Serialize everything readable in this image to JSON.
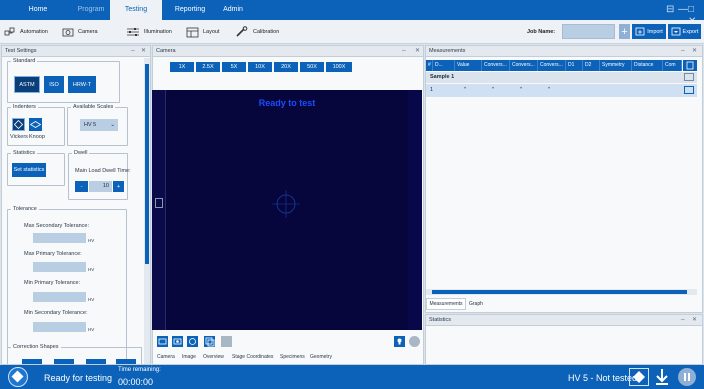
{
  "nav": {
    "tabs": [
      {
        "label": "Home"
      },
      {
        "label": "Program"
      },
      {
        "label": "Testing"
      },
      {
        "label": "Reporting"
      },
      {
        "label": "Admin"
      }
    ],
    "active_tab": "Testing",
    "window_controls": {
      "restore": "⊟",
      "minimize": "—",
      "close": "□ ✕"
    }
  },
  "toolbar": {
    "automation": "Automation",
    "camera": "Camera",
    "illumination": "Illumination",
    "layout": "Layout",
    "calibration": "Calibration",
    "job_name_label": "Job Name:",
    "job_name_value": "",
    "import": "Import",
    "export": "Export"
  },
  "test_settings": {
    "title": "Test Settings",
    "standard": {
      "legend": "Standard",
      "buttons": [
        "ASTM",
        "ISO",
        "HRW-T"
      ]
    },
    "indenters": {
      "legend": "Indenters",
      "vickers": "Vickers",
      "knoop": "Knoop"
    },
    "scales": {
      "legend": "Available Scales",
      "selected": "HV 5"
    },
    "statistics": {
      "legend": "Statistics",
      "button": "Set statistics"
    },
    "dwell": {
      "legend": "Dwell",
      "label": "Main Load Dwell Time:",
      "value": "10",
      "minus": "-",
      "plus": "+"
    },
    "tolerance": {
      "legend": "Tolerance",
      "rows": [
        {
          "label": "Max Secondary Tolerance:",
          "unit": "HV"
        },
        {
          "label": "Max Primary Tolerance:",
          "unit": "HV"
        },
        {
          "label": "Min Primary Tolerance:",
          "unit": "HV"
        },
        {
          "label": "Min Secondary Tolerance:",
          "unit": "HV"
        }
      ]
    },
    "correction": {
      "legend": "Correction Shapes"
    }
  },
  "camera": {
    "title": "Camera",
    "zoom_levels": [
      "1X",
      "2.5X",
      "5X",
      "10X",
      "20X",
      "50X",
      "100X"
    ],
    "overlay_text": "Ready to test",
    "tabs": [
      "Camera",
      "Image",
      "Overview",
      "Stage Coordinates",
      "Specimens",
      "Geometry"
    ]
  },
  "measurements": {
    "title": "Measurements",
    "columns": [
      "#",
      "D...",
      "Value",
      "Convers...",
      "Convers...",
      "Convers...",
      "D1",
      "D2",
      "Symmetry",
      "Distance",
      "Com"
    ],
    "sample_label": "Sample 1",
    "rows": [
      {
        "index": "1"
      }
    ],
    "tabs": [
      "Measurements",
      "Graph"
    ]
  },
  "statistics_panel": {
    "title": "Statistics"
  },
  "status": {
    "text": "Ready for testing",
    "time_label": "Time remaining:",
    "time_value": "00:00:00",
    "scale_status": "HV 5 - Not tested"
  },
  "colors": {
    "brand": "#0b62b8",
    "viewport": "#06063d",
    "overlay": "#1a4cff"
  }
}
